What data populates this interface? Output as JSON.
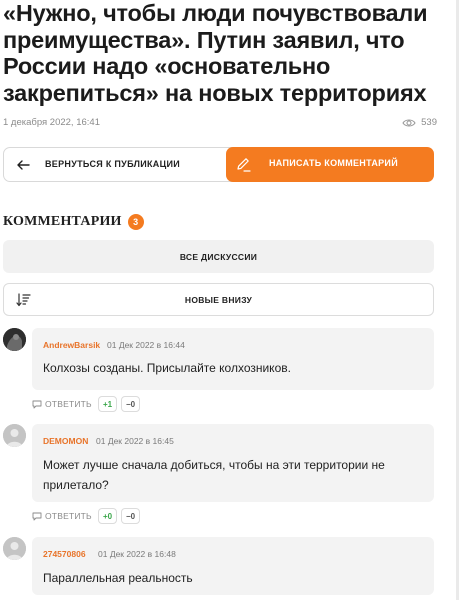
{
  "article": {
    "title": "«Нужно, чтобы люди почувствовали преимущества». Путин заявил, что России надо «основательно закрепиться» на новых территориях",
    "date": "1 декабря 2022, 16:41",
    "views": "539"
  },
  "buttons": {
    "back_label": "ВЕРНУТЬСЯ К ПУБЛИКАЦИИ",
    "write_label": "НАПИСАТЬ КОММЕНТАРИЙ"
  },
  "comments_section": {
    "heading": "КОММЕНТАРИИ",
    "count": "3",
    "all_discussions_label": "ВСЕ ДИСКУССИИ",
    "sort_label": "НОВЫЕ ВНИЗУ"
  },
  "comments": [
    {
      "author": "AndrewBarsik",
      "date": "01 Дек 2022 в 16:44",
      "text": "Колхозы созданы. Присылайте колхозников.",
      "reply_label": "ОТВЕТИТЬ",
      "plus": "+1",
      "minus": "−0"
    },
    {
      "author": "DEMOMON",
      "date": "01 Дек 2022 в 16:45",
      "text": "Может лучше сначала добиться, чтобы на эти территории не прилетало?",
      "reply_label": "ОТВЕТИТЬ",
      "plus": "+0",
      "minus": "−0"
    },
    {
      "author": "274570806",
      "date": "01 Дек 2022 в 16:48",
      "text": "Параллельная реальность"
    }
  ],
  "colors": {
    "accent": "#f47b20",
    "author": "#e8742a",
    "bubble": "#f3f3f3"
  }
}
